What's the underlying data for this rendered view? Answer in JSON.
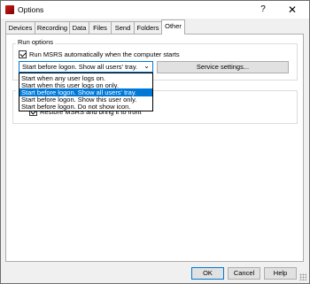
{
  "window": {
    "title": "Options"
  },
  "titlebar": {
    "help": "?",
    "close": "✕"
  },
  "tabs": [
    "Devices",
    "Recording",
    "Data",
    "Files",
    "Send",
    "Folders",
    "Other"
  ],
  "run_options": {
    "group_label": "Run options",
    "auto_run_label": "Run MSRS automatically when the computer starts",
    "auto_run_checked": true,
    "mode_selected": "Start before logon. Show all users' tray.",
    "mode_options": [
      "Start when any user logs on.",
      "Start when this user logs on only.",
      "Start before logon. Show all users' tray.",
      "Start before logon. Show this user only.",
      "Start before logon. Do not show icon."
    ],
    "service_button": "Service settings..."
  },
  "second_group": {
    "restore_label": "Restore MSRS and bring it to front",
    "restore_checked": true
  },
  "buttons": {
    "ok": "OK",
    "cancel": "Cancel",
    "help": "Help"
  }
}
